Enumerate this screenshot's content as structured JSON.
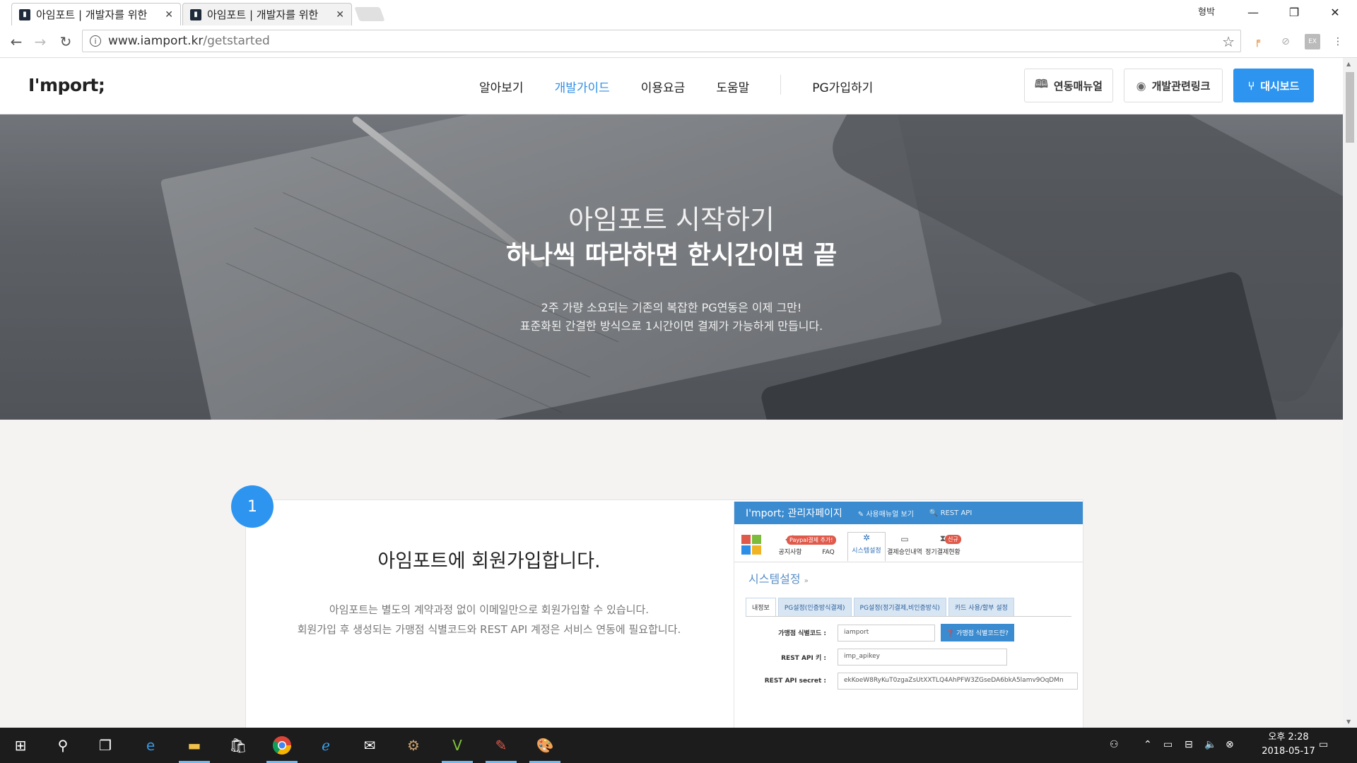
{
  "browser": {
    "tabs": [
      {
        "title": "아임포트 | 개발자를 위한",
        "active": true
      },
      {
        "title": "아임포트 | 개발자를 위한",
        "active": false
      }
    ],
    "profile": "형박",
    "url_domain": "www.iamport.kr",
    "url_path": "/getstarted"
  },
  "header": {
    "logo": "I'mport;",
    "nav": [
      "알아보기",
      "개발가이드",
      "이용요금",
      "도움말",
      "PG가입하기"
    ],
    "active_nav": "개발가이드",
    "buttons": {
      "manual": "연동매뉴얼",
      "links": "개발관련링크",
      "dashboard": "대시보드"
    }
  },
  "hero": {
    "title": "아임포트 시작하기",
    "subtitle": "하나씩 따라하면 한시간이면 끝",
    "desc1": "2주 가량 소요되는 기존의 복잡한 PG연동은 이제 그만!",
    "desc2": "표준화된 간결한 방식으로 1시간이면 결제가 가능하게 만듭니다."
  },
  "step1": {
    "number": "1",
    "title": "아임포트에 회원가입합니다.",
    "desc1": "아임포트는 별도의 계약과정 없이 이메일만으로 회원가입할 수 있습니다.",
    "desc2": "회원가입 후 생성되는 가맹점 식별코드와 REST API 계정은 서비스 연동에 필요합니다."
  },
  "admin_shot": {
    "title": "I'mport; 관리자페이지",
    "top_links": [
      "사용매뉴얼 보기",
      "REST API"
    ],
    "menu": [
      "공지사항",
      "FAQ",
      "시스템설정",
      "결제승인내역",
      "정기결제현황"
    ],
    "badges": {
      "notice": "Paypal결제 추가!",
      "recurring": "신규"
    },
    "breadcrumb": "시스템설정",
    "subtabs": [
      "내정보",
      "PG설정(인증방식결제)",
      "PG설정(정기결제,비인증방식)",
      "카드 사용/할부 설정"
    ],
    "fields": [
      {
        "label": "가맹점 식별코드 :",
        "value": "iamport",
        "button": "가맹점 식별코드란?"
      },
      {
        "label": "REST API 키 :",
        "value": "imp_apikey"
      },
      {
        "label": "REST API secret :",
        "value": "ekKoeW8RyKuT0zgaZsUtXXTLQ4AhPFW3ZGseDA6bkA5lamv9OqDMn"
      }
    ]
  },
  "taskbar": {
    "time": "오후 2:28",
    "date": "2018-05-17"
  }
}
